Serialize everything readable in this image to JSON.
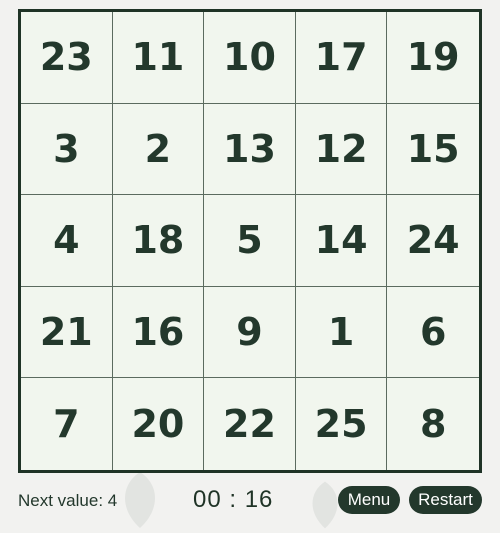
{
  "board": {
    "cells": [
      "23",
      "11",
      "10",
      "17",
      "19",
      "3",
      "2",
      "13",
      "12",
      "15",
      "4",
      "18",
      "5",
      "14",
      "24",
      "21",
      "16",
      "9",
      "1",
      "6",
      "7",
      "20",
      "22",
      "25",
      "8"
    ]
  },
  "footer": {
    "next_value": "Next value: 4",
    "timer": "00 : 16",
    "menu_label": "Menu",
    "restart_label": "Restart"
  },
  "colors": {
    "accent": "#23382c",
    "board_background": "#f1f6ee",
    "page_background": "#f2f2f0"
  }
}
